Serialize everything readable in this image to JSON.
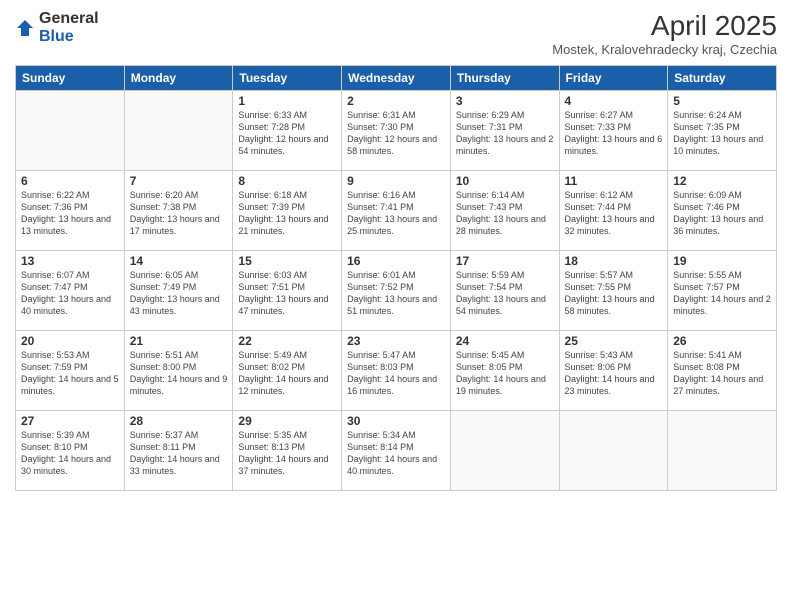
{
  "logo": {
    "general": "General",
    "blue": "Blue"
  },
  "title": "April 2025",
  "location": "Mostek, Kralovehradecky kraj, Czechia",
  "days_of_week": [
    "Sunday",
    "Monday",
    "Tuesday",
    "Wednesday",
    "Thursday",
    "Friday",
    "Saturday"
  ],
  "weeks": [
    [
      {
        "day": "",
        "sunrise": "",
        "sunset": "",
        "daylight": ""
      },
      {
        "day": "",
        "sunrise": "",
        "sunset": "",
        "daylight": ""
      },
      {
        "day": "1",
        "sunrise": "Sunrise: 6:33 AM",
        "sunset": "Sunset: 7:28 PM",
        "daylight": "Daylight: 12 hours and 54 minutes."
      },
      {
        "day": "2",
        "sunrise": "Sunrise: 6:31 AM",
        "sunset": "Sunset: 7:30 PM",
        "daylight": "Daylight: 12 hours and 58 minutes."
      },
      {
        "day": "3",
        "sunrise": "Sunrise: 6:29 AM",
        "sunset": "Sunset: 7:31 PM",
        "daylight": "Daylight: 13 hours and 2 minutes."
      },
      {
        "day": "4",
        "sunrise": "Sunrise: 6:27 AM",
        "sunset": "Sunset: 7:33 PM",
        "daylight": "Daylight: 13 hours and 6 minutes."
      },
      {
        "day": "5",
        "sunrise": "Sunrise: 6:24 AM",
        "sunset": "Sunset: 7:35 PM",
        "daylight": "Daylight: 13 hours and 10 minutes."
      }
    ],
    [
      {
        "day": "6",
        "sunrise": "Sunrise: 6:22 AM",
        "sunset": "Sunset: 7:36 PM",
        "daylight": "Daylight: 13 hours and 13 minutes."
      },
      {
        "day": "7",
        "sunrise": "Sunrise: 6:20 AM",
        "sunset": "Sunset: 7:38 PM",
        "daylight": "Daylight: 13 hours and 17 minutes."
      },
      {
        "day": "8",
        "sunrise": "Sunrise: 6:18 AM",
        "sunset": "Sunset: 7:39 PM",
        "daylight": "Daylight: 13 hours and 21 minutes."
      },
      {
        "day": "9",
        "sunrise": "Sunrise: 6:16 AM",
        "sunset": "Sunset: 7:41 PM",
        "daylight": "Daylight: 13 hours and 25 minutes."
      },
      {
        "day": "10",
        "sunrise": "Sunrise: 6:14 AM",
        "sunset": "Sunset: 7:43 PM",
        "daylight": "Daylight: 13 hours and 28 minutes."
      },
      {
        "day": "11",
        "sunrise": "Sunrise: 6:12 AM",
        "sunset": "Sunset: 7:44 PM",
        "daylight": "Daylight: 13 hours and 32 minutes."
      },
      {
        "day": "12",
        "sunrise": "Sunrise: 6:09 AM",
        "sunset": "Sunset: 7:46 PM",
        "daylight": "Daylight: 13 hours and 36 minutes."
      }
    ],
    [
      {
        "day": "13",
        "sunrise": "Sunrise: 6:07 AM",
        "sunset": "Sunset: 7:47 PM",
        "daylight": "Daylight: 13 hours and 40 minutes."
      },
      {
        "day": "14",
        "sunrise": "Sunrise: 6:05 AM",
        "sunset": "Sunset: 7:49 PM",
        "daylight": "Daylight: 13 hours and 43 minutes."
      },
      {
        "day": "15",
        "sunrise": "Sunrise: 6:03 AM",
        "sunset": "Sunset: 7:51 PM",
        "daylight": "Daylight: 13 hours and 47 minutes."
      },
      {
        "day": "16",
        "sunrise": "Sunrise: 6:01 AM",
        "sunset": "Sunset: 7:52 PM",
        "daylight": "Daylight: 13 hours and 51 minutes."
      },
      {
        "day": "17",
        "sunrise": "Sunrise: 5:59 AM",
        "sunset": "Sunset: 7:54 PM",
        "daylight": "Daylight: 13 hours and 54 minutes."
      },
      {
        "day": "18",
        "sunrise": "Sunrise: 5:57 AM",
        "sunset": "Sunset: 7:55 PM",
        "daylight": "Daylight: 13 hours and 58 minutes."
      },
      {
        "day": "19",
        "sunrise": "Sunrise: 5:55 AM",
        "sunset": "Sunset: 7:57 PM",
        "daylight": "Daylight: 14 hours and 2 minutes."
      }
    ],
    [
      {
        "day": "20",
        "sunrise": "Sunrise: 5:53 AM",
        "sunset": "Sunset: 7:59 PM",
        "daylight": "Daylight: 14 hours and 5 minutes."
      },
      {
        "day": "21",
        "sunrise": "Sunrise: 5:51 AM",
        "sunset": "Sunset: 8:00 PM",
        "daylight": "Daylight: 14 hours and 9 minutes."
      },
      {
        "day": "22",
        "sunrise": "Sunrise: 5:49 AM",
        "sunset": "Sunset: 8:02 PM",
        "daylight": "Daylight: 14 hours and 12 minutes."
      },
      {
        "day": "23",
        "sunrise": "Sunrise: 5:47 AM",
        "sunset": "Sunset: 8:03 PM",
        "daylight": "Daylight: 14 hours and 16 minutes."
      },
      {
        "day": "24",
        "sunrise": "Sunrise: 5:45 AM",
        "sunset": "Sunset: 8:05 PM",
        "daylight": "Daylight: 14 hours and 19 minutes."
      },
      {
        "day": "25",
        "sunrise": "Sunrise: 5:43 AM",
        "sunset": "Sunset: 8:06 PM",
        "daylight": "Daylight: 14 hours and 23 minutes."
      },
      {
        "day": "26",
        "sunrise": "Sunrise: 5:41 AM",
        "sunset": "Sunset: 8:08 PM",
        "daylight": "Daylight: 14 hours and 27 minutes."
      }
    ],
    [
      {
        "day": "27",
        "sunrise": "Sunrise: 5:39 AM",
        "sunset": "Sunset: 8:10 PM",
        "daylight": "Daylight: 14 hours and 30 minutes."
      },
      {
        "day": "28",
        "sunrise": "Sunrise: 5:37 AM",
        "sunset": "Sunset: 8:11 PM",
        "daylight": "Daylight: 14 hours and 33 minutes."
      },
      {
        "day": "29",
        "sunrise": "Sunrise: 5:35 AM",
        "sunset": "Sunset: 8:13 PM",
        "daylight": "Daylight: 14 hours and 37 minutes."
      },
      {
        "day": "30",
        "sunrise": "Sunrise: 5:34 AM",
        "sunset": "Sunset: 8:14 PM",
        "daylight": "Daylight: 14 hours and 40 minutes."
      },
      {
        "day": "",
        "sunrise": "",
        "sunset": "",
        "daylight": ""
      },
      {
        "day": "",
        "sunrise": "",
        "sunset": "",
        "daylight": ""
      },
      {
        "day": "",
        "sunrise": "",
        "sunset": "",
        "daylight": ""
      }
    ]
  ]
}
